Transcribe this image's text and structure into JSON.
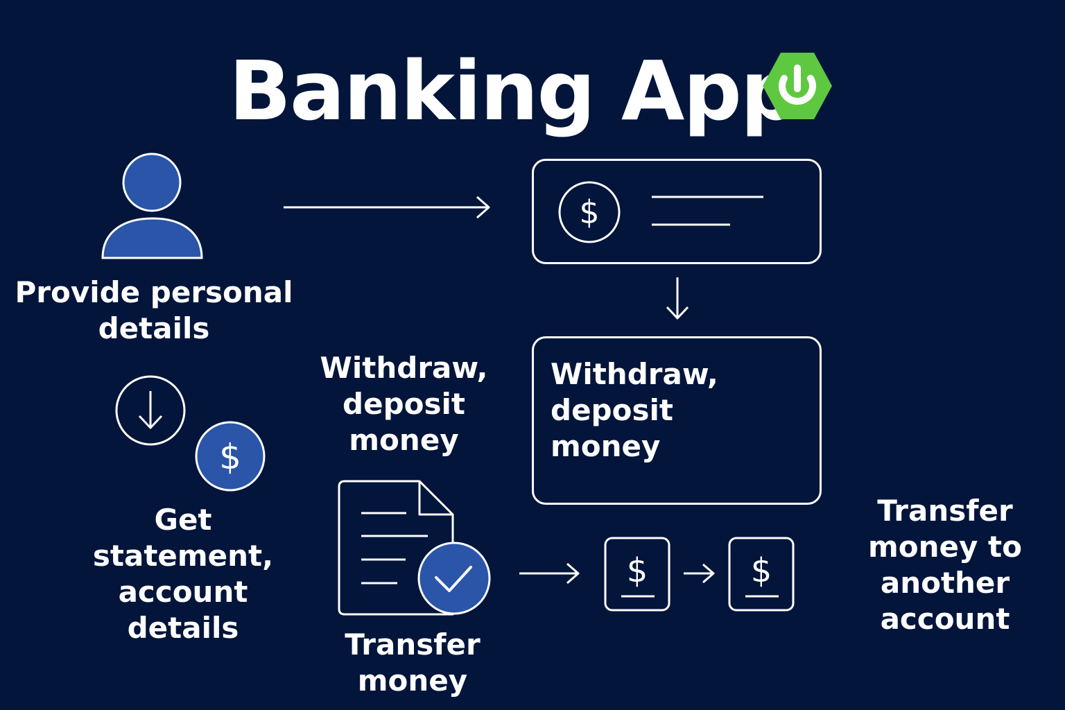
{
  "title": "Banking App",
  "colors": {
    "background": "#03153a",
    "accent_blue": "#2a55a8",
    "logo_green": "#5fc841",
    "stroke": "#ffffff"
  },
  "icons": {
    "logo": "power-icon",
    "user": "user-icon",
    "account_card": "dollar-card-icon",
    "down_arrow": "arrow-down-circle-icon",
    "dollar_coin": "dollar-coin-icon",
    "document": "document-check-icon",
    "transfer_from": "dollar-receipt-icon",
    "transfer_to": "dollar-receipt-icon"
  },
  "labels": {
    "personal_details": "Provide personal\ndetails",
    "get_statement": "Get statement,\naccount details",
    "withdraw_left": "Withdraw,\ndeposit money",
    "withdraw_box": "Withdraw, deposit\nmoney",
    "transfer_money": "Transfer\nmoney",
    "transfer_to_another": "Transfer\nmoney to\nanother account"
  }
}
